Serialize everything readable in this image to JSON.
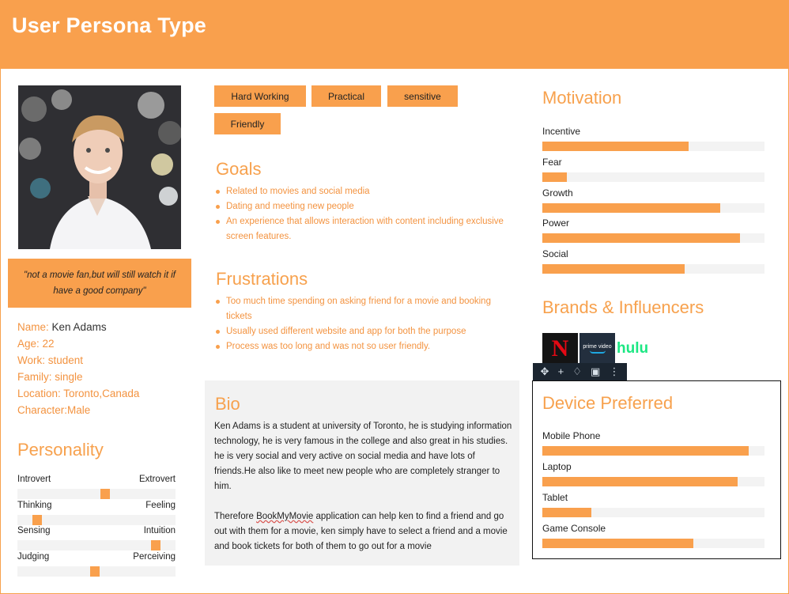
{
  "header": {
    "title": "User Persona Type"
  },
  "quote": "\"not a movie fan,but will still watch it if have a good company\"",
  "profile": {
    "name_label": "Name:",
    "name_value": "Ken Adams",
    "age": "Age: 22",
    "work": "Work: student",
    "family": "Family: single",
    "location": "Location: Toronto,Canada",
    "character": "Character:Male"
  },
  "personality": {
    "title": "Personality",
    "traits": [
      {
        "left": "Introvert",
        "right": "Extrovert",
        "value": 0.56
      },
      {
        "left": "Thinking",
        "right": "Feeling",
        "value": 0.1
      },
      {
        "left": "Sensing",
        "right": "Intuition",
        "value": 0.9
      },
      {
        "left": "Judging",
        "right": "Perceiving",
        "value": 0.49
      }
    ]
  },
  "tags": [
    "Hard Working",
    "Practical",
    "sensitive",
    "Friendly"
  ],
  "goals": {
    "title": "Goals",
    "items": [
      "Related to movies and social media",
      "Dating and meeting new people",
      "An experience that allows interaction with content including exclusive screen features."
    ]
  },
  "frustrations": {
    "title": "Frustrations",
    "items": [
      "Too much time spending on asking friend for a movie and booking tickets",
      "Usually used different website and app for both the purpose",
      "Process was too long and was not so user friendly."
    ]
  },
  "bio": {
    "title": "Bio",
    "para1": "Ken Adams is a student at university of Toronto, he is studying information technology, he is very famous in the college and also great in his studies. he is very social and very active on social media and have lots of friends.He also like to meet new people who are completely stranger to him.",
    "para2_before": "Therefore ",
    "para2_app": "BookMyMovie",
    "para2_after": " application can help ken to find a friend and go out with them for a movie, ken simply have to select a friend and a movie and book tickets for both of them to go out for a movie"
  },
  "motivation": {
    "title": "Motivation",
    "items": [
      {
        "label": "Incentive",
        "value": 0.66
      },
      {
        "label": "Fear",
        "value": 0.11
      },
      {
        "label": "Growth",
        "value": 0.8
      },
      {
        "label": "Power",
        "value": 0.89
      },
      {
        "label": "Social",
        "value": 0.64
      }
    ]
  },
  "brands": {
    "title": "Brands & Influencers",
    "netflix": "N",
    "prime": "prime video",
    "hulu": "hulu"
  },
  "devices": {
    "title": "Device Preferred",
    "items": [
      {
        "label": "Mobile Phone",
        "value": 0.93
      },
      {
        "label": "Laptop",
        "value": 0.88
      },
      {
        "label": "Tablet",
        "value": 0.22
      },
      {
        "label": "Game Console",
        "value": 0.68
      }
    ]
  },
  "toolbar_icons": [
    "move-icon",
    "plus-icon",
    "drop-icon",
    "image-icon",
    "more-icon"
  ],
  "colors": {
    "accent": "#f9a04d",
    "track": "#f3f3f3",
    "bio_bg": "#f2f2f2"
  }
}
